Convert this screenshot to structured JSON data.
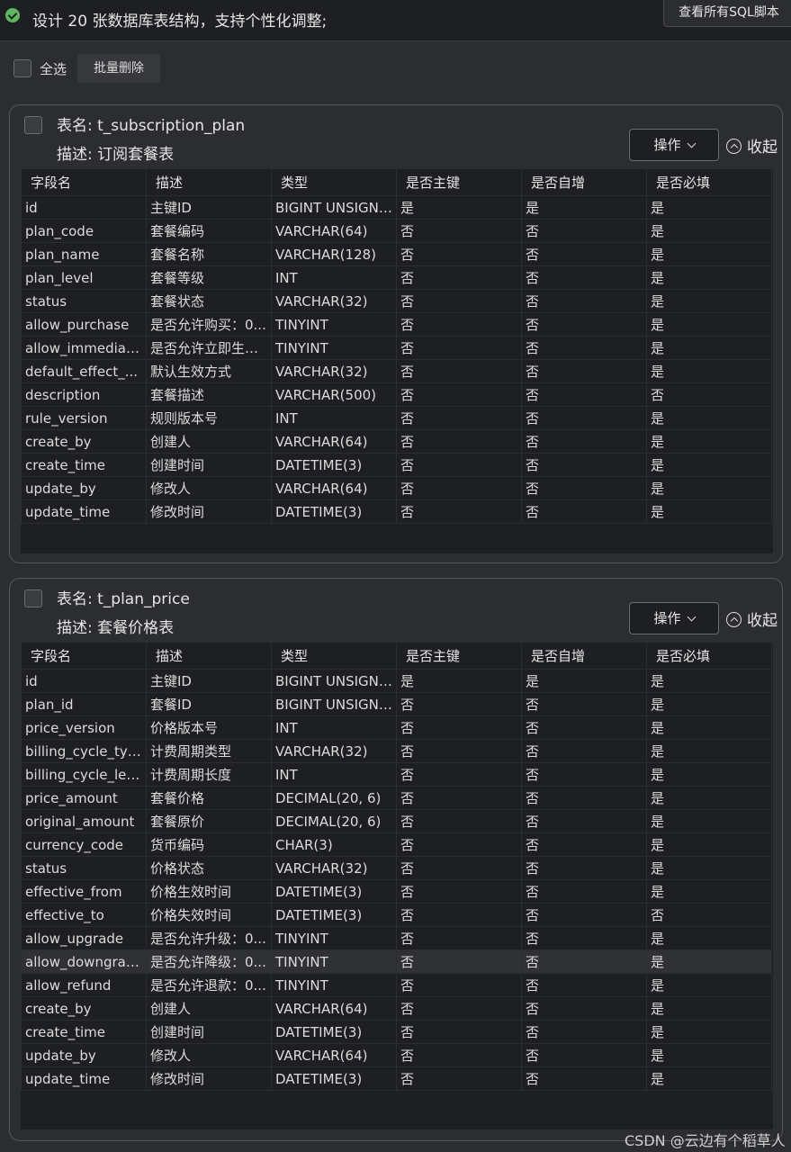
{
  "header": {
    "message": "设计 20 张数据库表结构，支持个性化调整;",
    "view_sql_label": "查看所有SQL脚本"
  },
  "toolbar": {
    "select_all_label": "全选",
    "batch_delete_label": "批量删除"
  },
  "columns": [
    "字段名",
    "描述",
    "类型",
    "是否主键",
    "是否自增",
    "是否必填"
  ],
  "tables": [
    {
      "name_line": "表名: t_subscription_plan",
      "desc_line": "描述: 订阅套餐表",
      "op_label": "操作",
      "collapse_label": "收起",
      "rows": [
        [
          "id",
          "主键ID",
          "BIGINT UNSIGNED",
          "是",
          "是",
          "是"
        ],
        [
          "plan_code",
          "套餐编码",
          "VARCHAR(64)",
          "否",
          "否",
          "是"
        ],
        [
          "plan_name",
          "套餐名称",
          "VARCHAR(128)",
          "否",
          "否",
          "是"
        ],
        [
          "plan_level",
          "套餐等级",
          "INT",
          "否",
          "否",
          "是"
        ],
        [
          "status",
          "套餐状态",
          "VARCHAR(32)",
          "否",
          "否",
          "是"
        ],
        [
          "allow_purchase",
          "是否允许购买：0...",
          "TINYINT",
          "否",
          "否",
          "是"
        ],
        [
          "allow_immediat...",
          "是否允许立即生效...",
          "TINYINT",
          "否",
          "否",
          "是"
        ],
        [
          "default_effect_...",
          "默认生效方式",
          "VARCHAR(32)",
          "否",
          "否",
          "是"
        ],
        [
          "description",
          "套餐描述",
          "VARCHAR(500)",
          "否",
          "否",
          "否"
        ],
        [
          "rule_version",
          "规则版本号",
          "INT",
          "否",
          "否",
          "是"
        ],
        [
          "create_by",
          "创建人",
          "VARCHAR(64)",
          "否",
          "否",
          "是"
        ],
        [
          "create_time",
          "创建时间",
          "DATETIME(3)",
          "否",
          "否",
          "是"
        ],
        [
          "update_by",
          "修改人",
          "VARCHAR(64)",
          "否",
          "否",
          "是"
        ],
        [
          "update_time",
          "修改时间",
          "DATETIME(3)",
          "否",
          "否",
          "是"
        ]
      ]
    },
    {
      "name_line": "表名: t_plan_price",
      "desc_line": "描述: 套餐价格表",
      "op_label": "操作",
      "collapse_label": "收起",
      "rows": [
        [
          "id",
          "主键ID",
          "BIGINT UNSIGNED",
          "是",
          "是",
          "是"
        ],
        [
          "plan_id",
          "套餐ID",
          "BIGINT UNSIGNED",
          "否",
          "否",
          "是"
        ],
        [
          "price_version",
          "价格版本号",
          "INT",
          "否",
          "否",
          "是"
        ],
        [
          "billing_cycle_type",
          "计费周期类型",
          "VARCHAR(32)",
          "否",
          "否",
          "是"
        ],
        [
          "billing_cycle_len...",
          "计费周期长度",
          "INT",
          "否",
          "否",
          "是"
        ],
        [
          "price_amount",
          "套餐价格",
          "DECIMAL(20, 6)",
          "否",
          "否",
          "是"
        ],
        [
          "original_amount",
          "套餐原价",
          "DECIMAL(20, 6)",
          "否",
          "否",
          "是"
        ],
        [
          "currency_code",
          "货币编码",
          "CHAR(3)",
          "否",
          "否",
          "是"
        ],
        [
          "status",
          "价格状态",
          "VARCHAR(32)",
          "否",
          "否",
          "是"
        ],
        [
          "effective_from",
          "价格生效时间",
          "DATETIME(3)",
          "否",
          "否",
          "是"
        ],
        [
          "effective_to",
          "价格失效时间",
          "DATETIME(3)",
          "否",
          "否",
          "否"
        ],
        [
          "allow_upgrade",
          "是否允许升级：0...",
          "TINYINT",
          "否",
          "否",
          "是"
        ],
        [
          "allow_downgrade",
          "是否允许降级：0...",
          "TINYINT",
          "否",
          "否",
          "是"
        ],
        [
          "allow_refund",
          "是否允许退款：0...",
          "TINYINT",
          "否",
          "否",
          "是"
        ],
        [
          "create_by",
          "创建人",
          "VARCHAR(64)",
          "否",
          "否",
          "是"
        ],
        [
          "create_time",
          "创建时间",
          "DATETIME(3)",
          "否",
          "否",
          "是"
        ],
        [
          "update_by",
          "修改人",
          "VARCHAR(64)",
          "否",
          "否",
          "是"
        ],
        [
          "update_time",
          "修改时间",
          "DATETIME(3)",
          "否",
          "否",
          "是"
        ]
      ]
    }
  ],
  "watermark": "CSDN @云边有个稻草人"
}
